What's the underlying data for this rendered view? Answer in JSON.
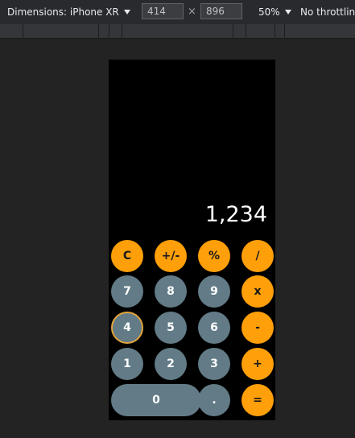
{
  "devtools": {
    "device_label": "Dimensions: iPhone XR",
    "width_value": "414",
    "height_value": "896",
    "times_symbol": "×",
    "zoom_label": "50%",
    "throttle_label": "No throttlin"
  },
  "calculator": {
    "display": "1,234",
    "keys": {
      "clear": "C",
      "sign": "+/-",
      "percent": "%",
      "divide": "/",
      "seven": "7",
      "eight": "8",
      "nine": "9",
      "multiply": "x",
      "four": "4",
      "five": "5",
      "six": "6",
      "subtract": "-",
      "one": "1",
      "two": "2",
      "three": "3",
      "add": "+",
      "zero": "0",
      "decimal": ".",
      "equals": "="
    },
    "colors": {
      "operator": "#ff9f0a",
      "digit": "#627b87",
      "background": "#000000",
      "focus_ring": "#e0a43a"
    }
  }
}
